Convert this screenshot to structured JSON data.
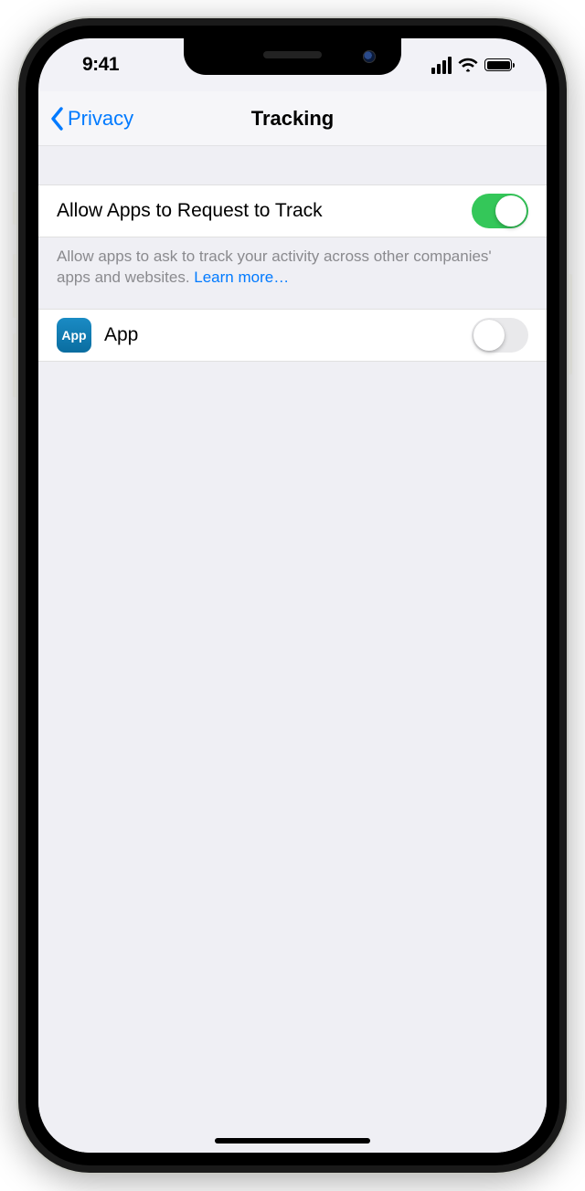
{
  "status": {
    "time": "9:41"
  },
  "nav": {
    "back_label": "Privacy",
    "title": "Tracking"
  },
  "settings": {
    "allow_request": {
      "label": "Allow Apps to Request to Track",
      "on": true
    },
    "footer_text": "Allow apps to ask to track your activity across other companies' apps and websites. ",
    "learn_more": "Learn more…",
    "apps": [
      {
        "icon_label": "App",
        "name": "App",
        "on": false
      }
    ]
  }
}
